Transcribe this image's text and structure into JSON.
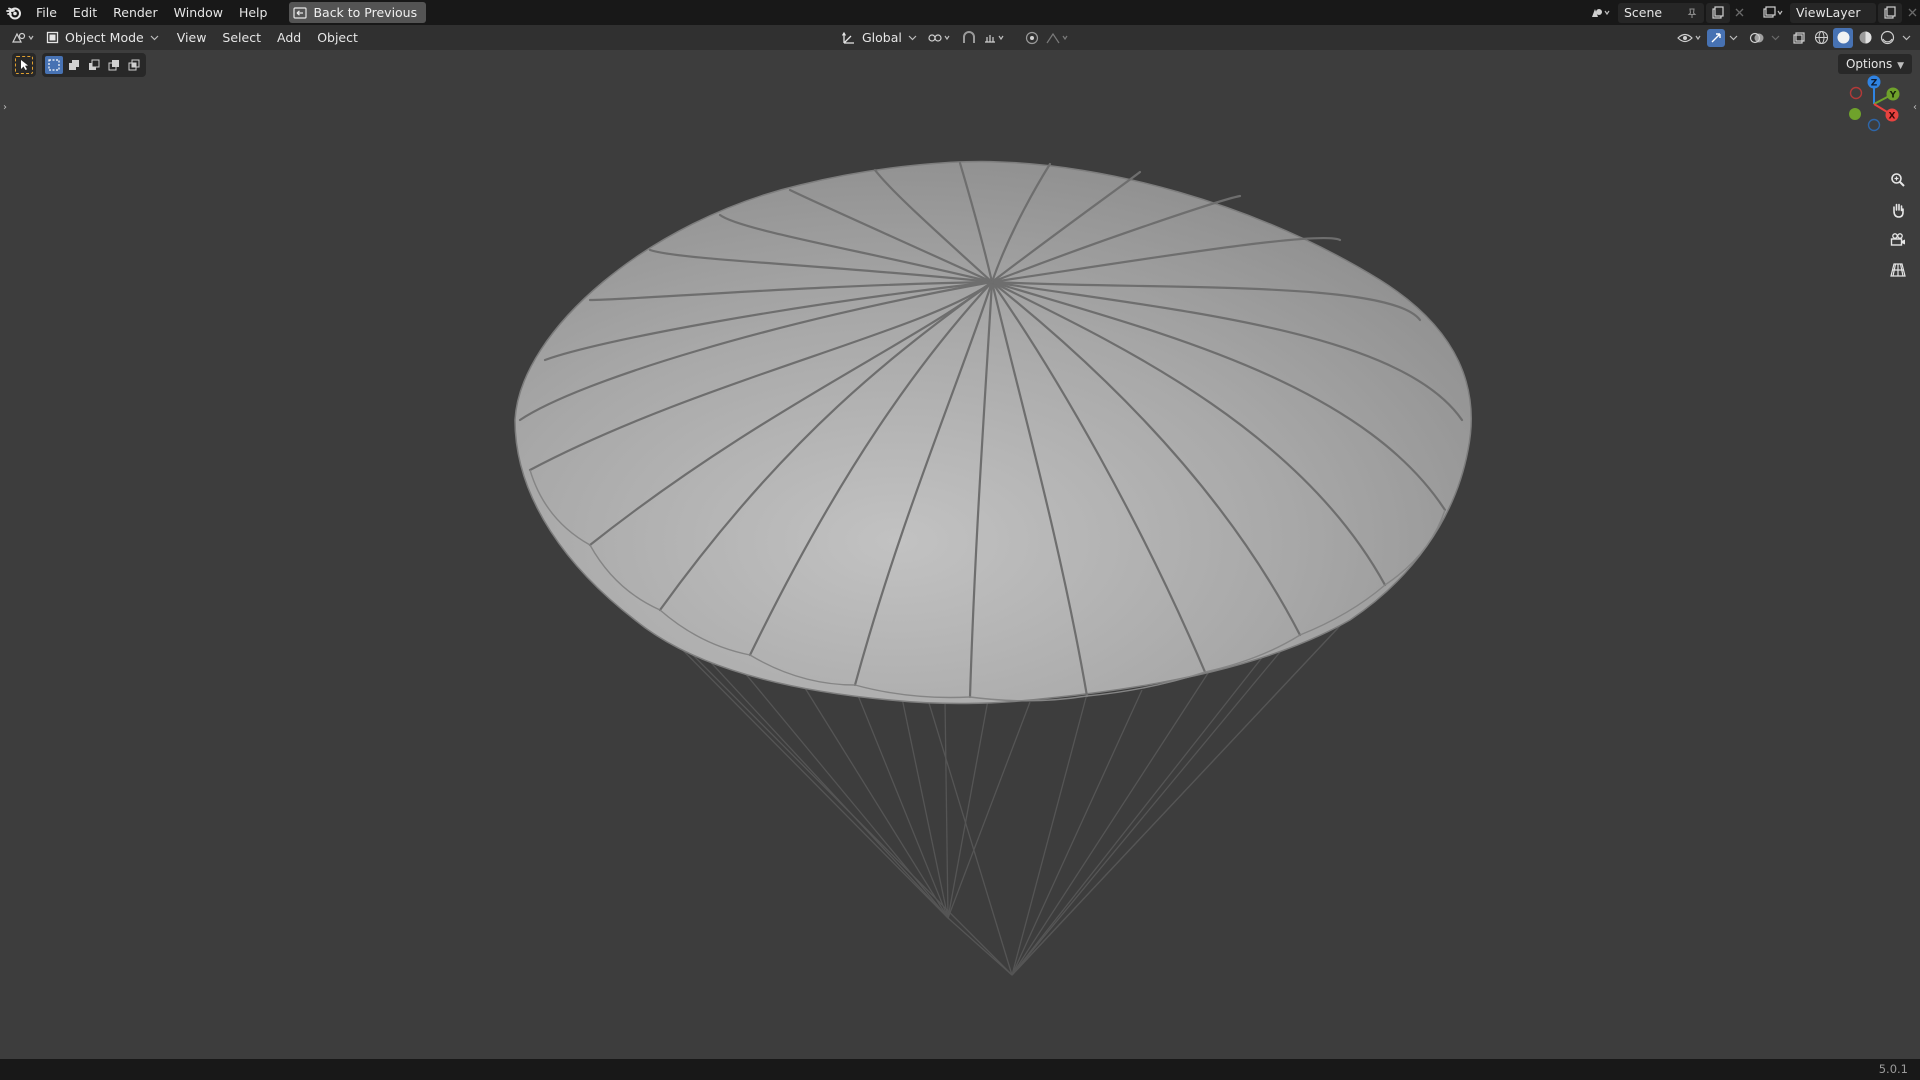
{
  "topbar": {
    "menus": [
      "File",
      "Edit",
      "Render",
      "Window",
      "Help"
    ],
    "back_button": "Back to Previous",
    "scene_name": "Scene",
    "view_layer": "ViewLayer"
  },
  "header": {
    "mode": "Object Mode",
    "menus": [
      "View",
      "Select",
      "Add",
      "Object"
    ],
    "transform_orientation": "Global"
  },
  "viewport": {
    "options_label": "Options",
    "object": "parachute",
    "gizmo_axes": {
      "x": "X",
      "y": "Y",
      "z": "Z"
    }
  },
  "statusbar": {
    "version": "5.0.1"
  },
  "colors": {
    "viewport_bg": "#3d3d3d",
    "topbar_bg": "#181818",
    "header_bg": "#303030",
    "axis_x": "#e8423f",
    "axis_y": "#6fa22b",
    "axis_z": "#2f83e3",
    "accent": "#4772b3"
  }
}
